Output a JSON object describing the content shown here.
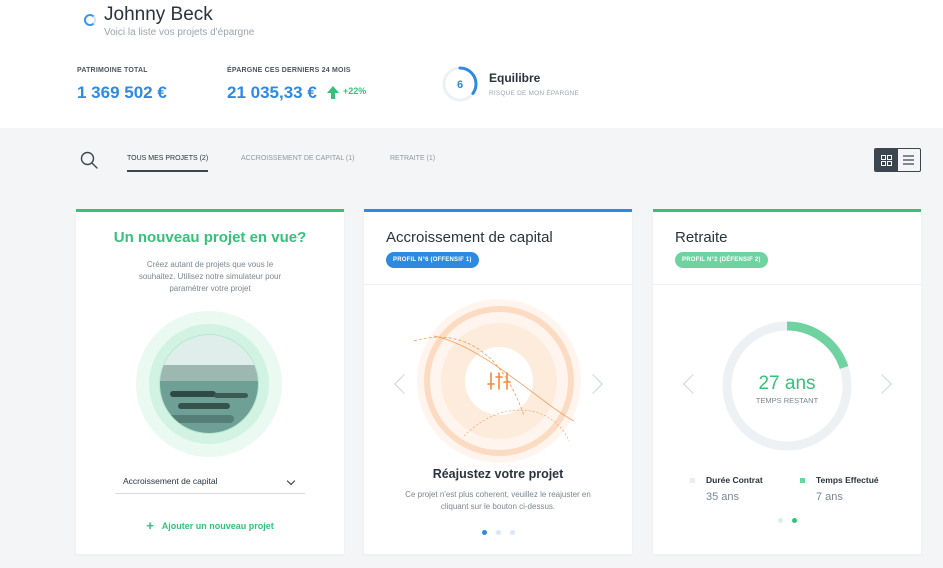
{
  "user": {
    "name": "Johnny Beck",
    "subtitle": "Voici la liste vos projets d'épargne"
  },
  "kpis": {
    "patrimoine_label": "PATRIMOINE TOTAL",
    "patrimoine_value": "1 369 502 €",
    "epargne_label": "ÉPARGNE CES DERNIERS 24 MOIS",
    "epargne_value": "21 035,33 €",
    "epargne_delta": "+22%"
  },
  "risk": {
    "level": "6",
    "title": "Equilibre",
    "subtitle": "RISQUE DE MON ÉPARGNE",
    "fraction": 0.35
  },
  "tabs": [
    {
      "label": "TOUS MES PROJETS (2)",
      "active": true
    },
    {
      "label": "ACCROISSEMENT DE CAPITAL (1)",
      "active": false
    },
    {
      "label": "RETRAITE (1)",
      "active": false
    }
  ],
  "new_project": {
    "title": "Un nouveau projet en vue?",
    "description": "Créez autant de projets que vous le souhaitez. Utilisez notre simulateur pour paramétrer votre projet",
    "select_value": "Accroissement de capital",
    "add_label": "Ajouter un nouveau projet"
  },
  "capital_card": {
    "title": "Accroissement de capital",
    "badge": "PROFIL N°6 (OFFENSIF 1)",
    "action_title": "Réajustez votre projet",
    "action_desc": "Ce projet n'est plus coherent, veuillez le reajuster en cliquant sur le bouton ci-dessus."
  },
  "retraite_card": {
    "title": "Retraite",
    "badge": "PROFIL N°2 (DÉFENSIF 2)",
    "gauge_value": "27 ans",
    "gauge_label": "TEMPS RESTANT",
    "progress_fraction": 0.2,
    "duree_label": "Durée Contrat",
    "duree_value": "35 ans",
    "temps_label": "Temps Effectué",
    "temps_value": "7 ans"
  },
  "colors": {
    "green": "#34c27b",
    "blue": "#2d8ae0",
    "orange": "#f5b07a",
    "dark": "#3c4650"
  },
  "icons": [
    "user-icon",
    "search-icon",
    "grid-view-icon",
    "list-view-icon",
    "sliders-icon",
    "chevron-left-icon",
    "chevron-right-icon",
    "plus-icon"
  ]
}
